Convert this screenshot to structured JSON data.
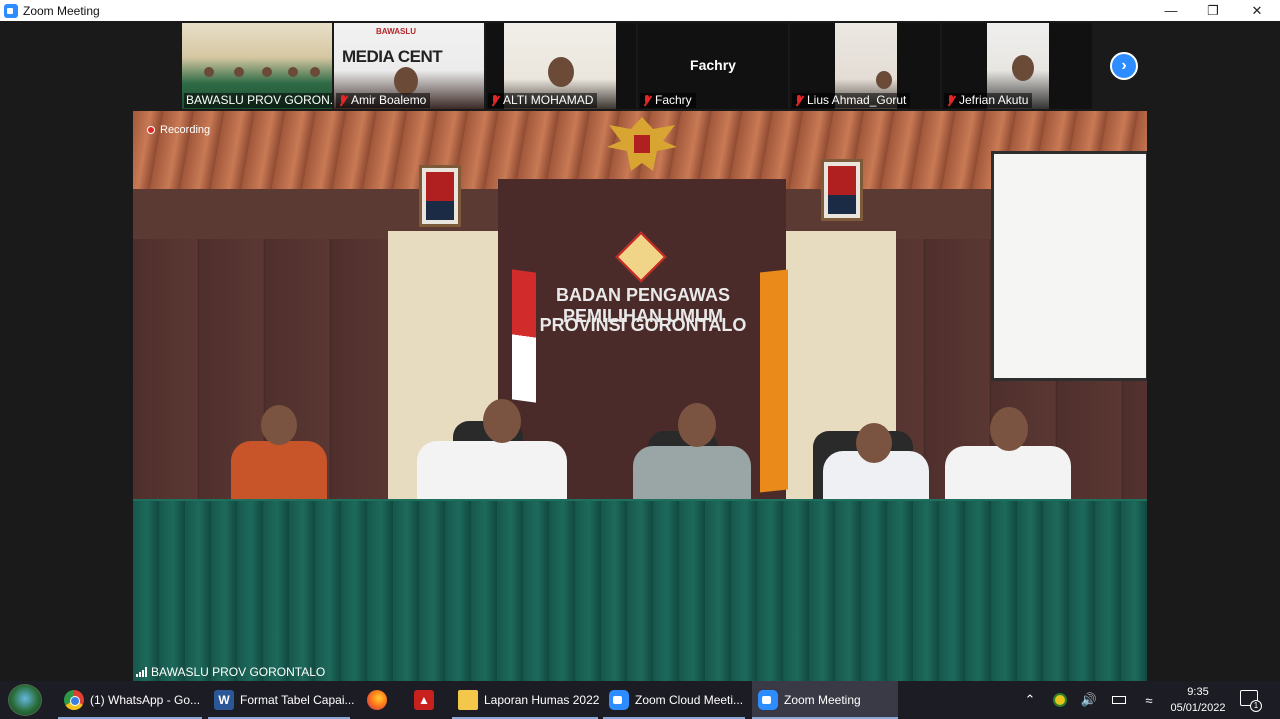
{
  "window": {
    "title": "Zoom Meeting",
    "minimize_icon": "minimize-icon",
    "maximize_icon": "restore-icon",
    "close_icon": "close-icon"
  },
  "thumbnails": [
    {
      "name": "BAWASLU PROV GORON...",
      "muted": false,
      "active": true
    },
    {
      "name": "Amir Boalemo",
      "muted": true,
      "banner": "MEDIA CENT",
      "brand": "BAWASLU"
    },
    {
      "name": "ALTI MOHAMAD",
      "muted": true
    },
    {
      "name": "Fachry",
      "muted": true,
      "display_name": "Fachry"
    },
    {
      "name": "Lius Ahmad_Gorut",
      "muted": true
    },
    {
      "name": "Jefrian Akutu",
      "muted": true
    }
  ],
  "next_page_icon": "chevron-right-icon",
  "main_video": {
    "recording_label": "Recording",
    "speaker_name": "BAWASLU PROV GORONTALO",
    "sign_line1": "BADAN PENGAWAS PEMILIHAN UMUM",
    "sign_line2": "PROVINSI GORONTALO"
  },
  "taskbar": {
    "start_icon": "windows-start-icon",
    "items": [
      {
        "label": "(1) WhatsApp - Go...",
        "icon": "chrome-icon"
      },
      {
        "label": "Format Tabel Capai...",
        "icon": "word-icon"
      },
      {
        "label": "",
        "icon": "firefox-icon"
      },
      {
        "label": "",
        "icon": "pdf-icon"
      },
      {
        "label": "Laporan Humas 2022",
        "icon": "folder-icon"
      },
      {
        "label": "Zoom Cloud Meeti...",
        "icon": "zoom-icon"
      },
      {
        "label": "Zoom Meeting",
        "icon": "zoom-icon",
        "active": true
      }
    ],
    "tray": {
      "time": "9:35",
      "date": "05/01/2022",
      "notification_count": "1"
    }
  },
  "colors": {
    "zoom_blue": "#2d8cff",
    "active_border": "#7cc242",
    "muted_red": "#e02828"
  }
}
